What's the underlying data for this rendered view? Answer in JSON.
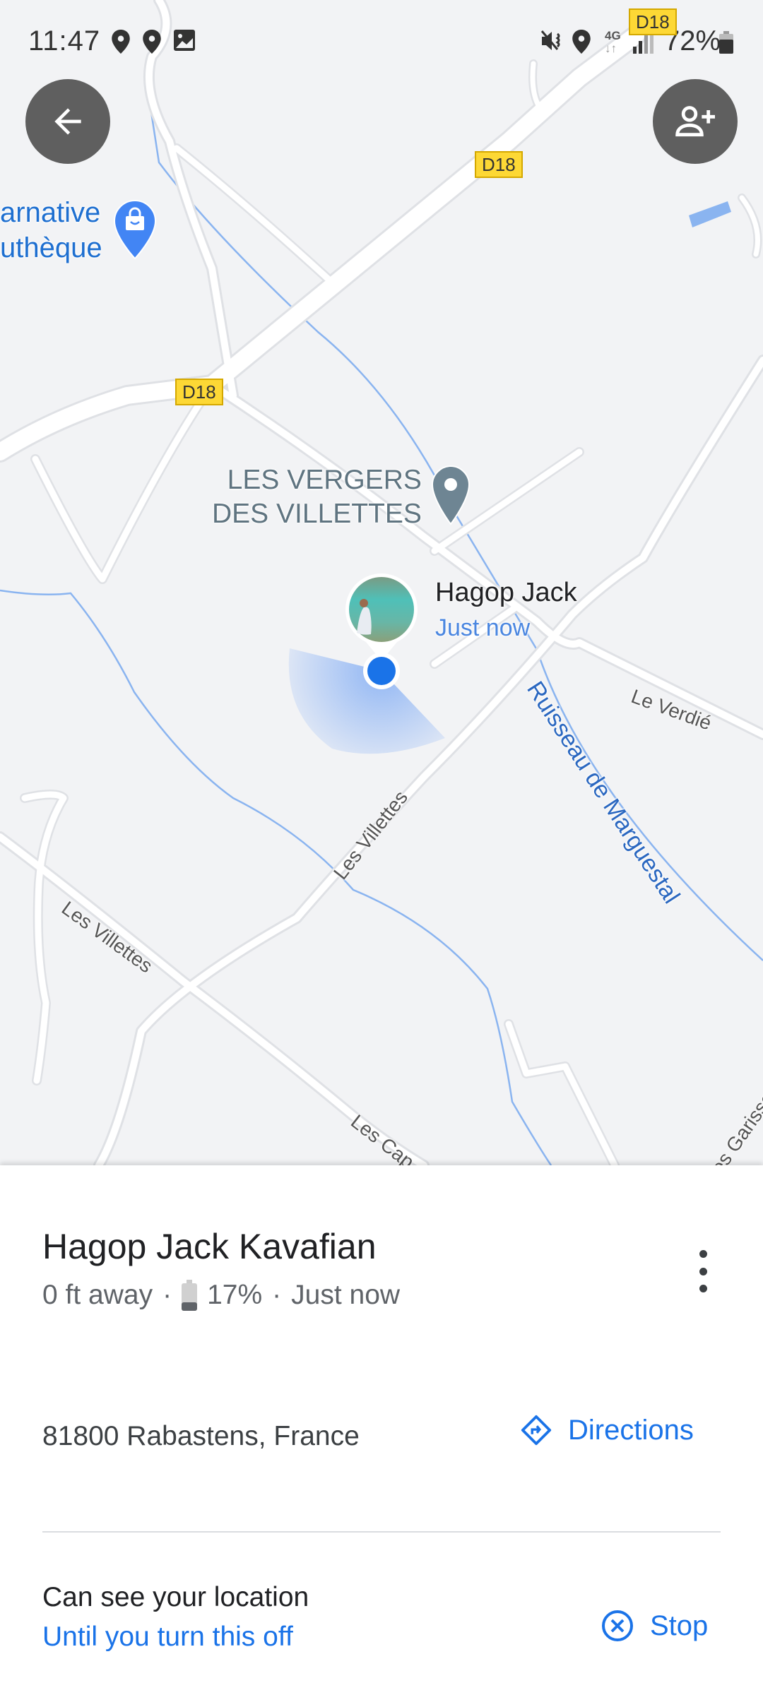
{
  "status_bar": {
    "time": "11:47",
    "left_icons": [
      "location-pin-icon",
      "location-pin-icon",
      "image-icon"
    ],
    "right_icons": [
      "vibrate-mute-icon",
      "location-pin-icon",
      "4g-data-icon",
      "signal-icon"
    ],
    "network": "4G",
    "battery_percent": "72%"
  },
  "map": {
    "back_button": "back",
    "add_person_button": "add person",
    "road_shields": [
      "D18",
      "D18",
      "D18"
    ],
    "shop_label": {
      "line1": "arnative",
      "line2": "uthèque"
    },
    "poi_label": {
      "line1": "LES VERGERS",
      "line2": "DES VILLETTES"
    },
    "road_labels": {
      "le_verdie": "Le Verdié",
      "les_villettes_1": "Les Villettes",
      "les_villettes_2": "Les Villettes",
      "les_cap": "Les Cap",
      "garissol": "es Garissol"
    },
    "river_label": "Ruisseau de Marguestal",
    "person_marker": {
      "name": "Hagop Jack",
      "time": "Just now"
    }
  },
  "sheet": {
    "contact_name": "Hagop Jack Kavafian",
    "distance": "0 ft away",
    "separator": "·",
    "battery": "17%",
    "battery_level": 0.17,
    "last_seen": "Just now",
    "address": "81800 Rabastens, France",
    "directions_label": "Directions",
    "share_title": "Can see your location",
    "share_until": "Until you turn this off",
    "stop_label": "Stop"
  },
  "colors": {
    "accent": "#1a73e8",
    "map_bg": "#f2f3f5",
    "fab_bg": "#5f5f5f",
    "shield": "#fdd835"
  }
}
